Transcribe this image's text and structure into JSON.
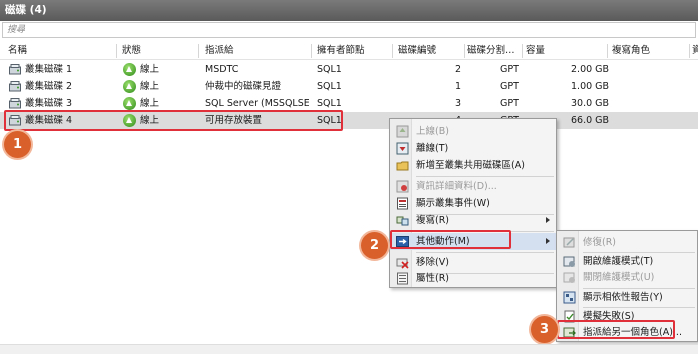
{
  "panel": {
    "title": "磁碟 (4)"
  },
  "search": {
    "placeholder": "搜尋"
  },
  "columns": [
    "名稱",
    "狀態",
    "指派給",
    "擁有者節點",
    "磁碟編號",
    "磁碟分割…",
    "容量",
    "複寫角色",
    "資"
  ],
  "disks": [
    {
      "name": "叢集磁碟 1",
      "status": "線上",
      "assigned_to": "MSDTC",
      "owner": "SQL1",
      "disk_no": "2",
      "partition": "GPT",
      "capacity": "2.00 GB"
    },
    {
      "name": "叢集磁碟 2",
      "status": "線上",
      "assigned_to": "仲裁中的磁碟見證",
      "owner": "SQL1",
      "disk_no": "1",
      "partition": "GPT",
      "capacity": "1.00 GB"
    },
    {
      "name": "叢集磁碟 3",
      "status": "線上",
      "assigned_to": "SQL Server (MSSQLSER…",
      "owner": "SQL1",
      "disk_no": "3",
      "partition": "GPT",
      "capacity": "30.0 GB"
    },
    {
      "name": "叢集磁碟 4",
      "status": "線上",
      "assigned_to": "可用存放裝置",
      "owner": "SQL1",
      "disk_no": "4",
      "partition": "GPT",
      "capacity": "66.0 GB"
    }
  ],
  "context_menu": {
    "items": [
      {
        "label": "上線(B)",
        "disabled": true
      },
      {
        "label": "離線(T)",
        "disabled": false
      },
      {
        "label": "新增至叢集共用磁碟區(A)",
        "disabled": false
      },
      {
        "label": "資訊詳細資料(D)...",
        "disabled": true
      },
      {
        "label": "顯示叢集事件(W)",
        "disabled": false
      },
      {
        "label": "複寫(R)",
        "disabled": false
      },
      {
        "label": "其他動作(M)",
        "disabled": false
      },
      {
        "label": "移除(V)",
        "disabled": false
      },
      {
        "label": "屬性(R)",
        "disabled": false
      }
    ]
  },
  "submenu": {
    "items": [
      {
        "label": "修復(R)",
        "disabled": true
      },
      {
        "label": "開啟維護模式(T)",
        "disabled": false
      },
      {
        "label": "關閉維護模式(U)",
        "disabled": true
      },
      {
        "label": "顯示相依性報告(Y)",
        "disabled": false
      },
      {
        "label": "模擬失敗(S)",
        "disabled": false
      },
      {
        "label": "指派給另一個角色(A)...",
        "disabled": false
      }
    ]
  },
  "badges": [
    "1",
    "2",
    "3"
  ],
  "colors": {
    "highlight_box": "#e0303a",
    "badge": "#d9602b",
    "titlebar": "#6a6a6a"
  }
}
